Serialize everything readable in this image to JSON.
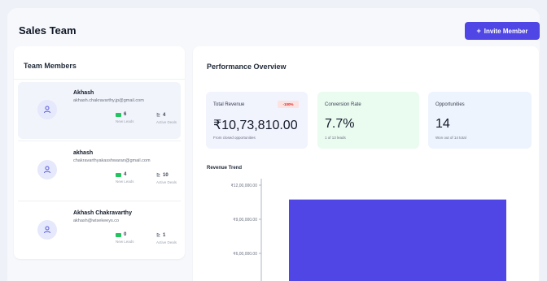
{
  "header": {
    "title": "Sales Team",
    "invite_label": "Invite Member"
  },
  "members_panel": {
    "title": "Team Members",
    "members": [
      {
        "name": "Akhash",
        "email": "akhash.chakravarthy.jp@gmail.com",
        "leads": "6",
        "leads_label": "New Leads",
        "deals": "4",
        "deals_label": "Active Deals"
      },
      {
        "name": "akhash",
        "email": "chakravarthyakasshwaran@gmail.com",
        "leads": "4",
        "leads_label": "New Leads",
        "deals": "10",
        "deals_label": "Active Deals"
      },
      {
        "name": "Akhash Chakravarthy",
        "email": "akhash@wisekeeys.co",
        "leads": "0",
        "leads_label": "New Leads",
        "deals": "1",
        "deals_label": "Active Deals"
      }
    ]
  },
  "performance": {
    "title": "Performance Overview",
    "kpis": {
      "revenue": {
        "label": "Total Revenue",
        "badge": "-100%",
        "value": "₹10,73,810.00",
        "sub": "From closed opportunities"
      },
      "conversion": {
        "label": "Conversion Rate",
        "value": "7.7%",
        "sub": "1 of 13 leads"
      },
      "opportunities": {
        "label": "Opportunities",
        "value": "14",
        "sub": "Won out of 14 total"
      }
    },
    "trend_title": "Revenue Trend"
  },
  "chart_data": {
    "type": "bar",
    "title": "Revenue Trend",
    "categories": [
      ""
    ],
    "series": [
      {
        "values": [
          1073810
        ]
      }
    ],
    "ylim": [
      0,
      1200000
    ],
    "yticks": [
      1200000,
      900000,
      600000
    ],
    "ytick_labels": [
      "₹12,00,000.00",
      "₹9,00,000.00",
      "₹6,00,000.00"
    ],
    "bar_color": "#4f46e5",
    "grid": false
  },
  "colors": {
    "accent": "#4f46e5",
    "positive": "#22c55e",
    "negative": "#dc2626"
  }
}
